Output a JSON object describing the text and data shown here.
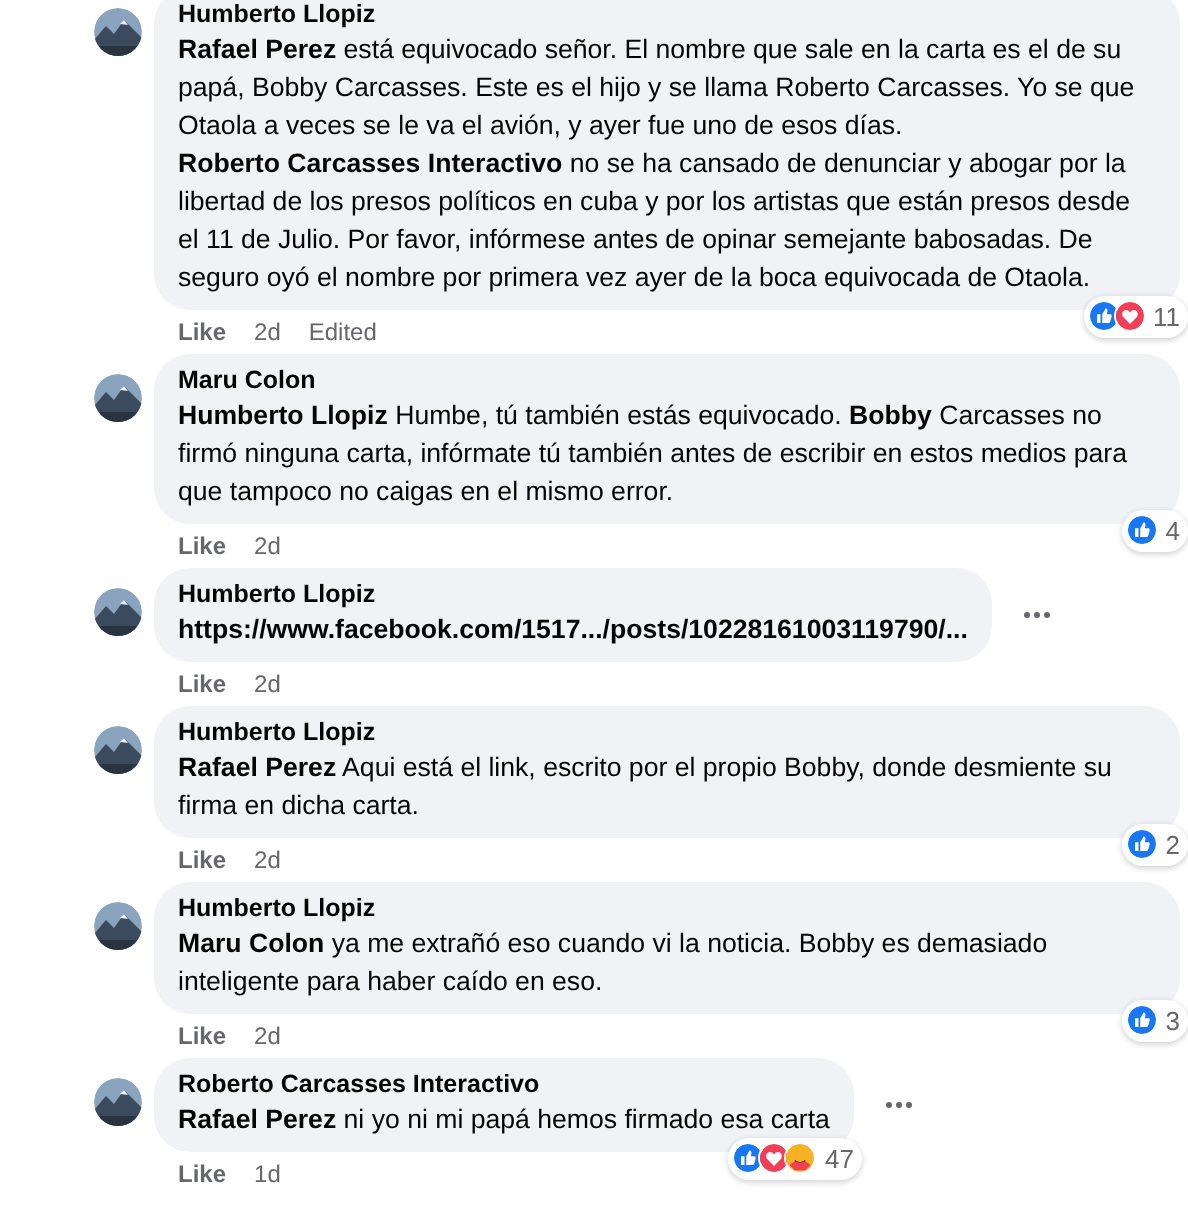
{
  "comments": [
    {
      "author": "Humberto Llopiz",
      "text": [
        "**Rafael Perez** está equivocado señor. El nombre que sale en la carta es el de su papá, Bobby Carcasses. Este es el hijo y se llama Roberto Carcasses. Yo se que Otaola a veces se le va el avión, y ayer fue uno de esos días.",
        "**Roberto Carcasses Interactivo** no se ha cansado de denunciar y abogar por la libertad de los presos políticos en cuba y por los artistas que están presos desde el 11 de Julio. Por favor, infórmese antes de opinar semejante babosadas. De seguro oyó el nombre por primera vez ayer de la boca equivocada de Otaola."
      ],
      "more": false,
      "like": "Like",
      "time": "2d",
      "edited": "Edited",
      "reactions": {
        "like": true,
        "love": true,
        "care": false,
        "count": "11"
      }
    },
    {
      "author": "Maru Colon",
      "text": [
        "**Humberto Llopiz** Humbe, tú también estás equivocado. **Bobby** Carcasses no firmó ninguna carta, infórmate tú también antes de escribir en estos medios para que tampoco no caigas en el mismo error."
      ],
      "more": false,
      "like": "Like",
      "time": "2d",
      "reactions": {
        "like": true,
        "love": false,
        "care": false,
        "count": "4"
      }
    },
    {
      "author": "Humberto Llopiz",
      "text": [
        "**https://www.facebook.com/1517.../posts/10228161003119790/...**"
      ],
      "more": true,
      "like": "Like",
      "time": "2d"
    },
    {
      "author": "Humberto Llopiz",
      "text": [
        "**Rafael Perez** Aqui está el link, escrito por el propio Bobby, donde desmiente su firma en dicha carta."
      ],
      "more": false,
      "like": "Like",
      "time": "2d",
      "reactions": {
        "like": true,
        "love": false,
        "care": false,
        "count": "2"
      }
    },
    {
      "author": "Humberto Llopiz",
      "text": [
        "**Maru Colon** ya me extrañó eso cuando vi la noticia. Bobby es demasiado inteligente para haber caído en eso."
      ],
      "more": false,
      "like": "Like",
      "time": "2d",
      "reactions": {
        "like": true,
        "love": false,
        "care": false,
        "count": "3"
      }
    },
    {
      "author": "Roberto Carcasses Interactivo",
      "text": [
        "**Rafael Perez** ni yo ni mi papá hemos firmado esa carta"
      ],
      "more": true,
      "like": "Like",
      "time": "1d",
      "reactions": {
        "like": true,
        "love": true,
        "care": true,
        "count": "47"
      }
    }
  ]
}
